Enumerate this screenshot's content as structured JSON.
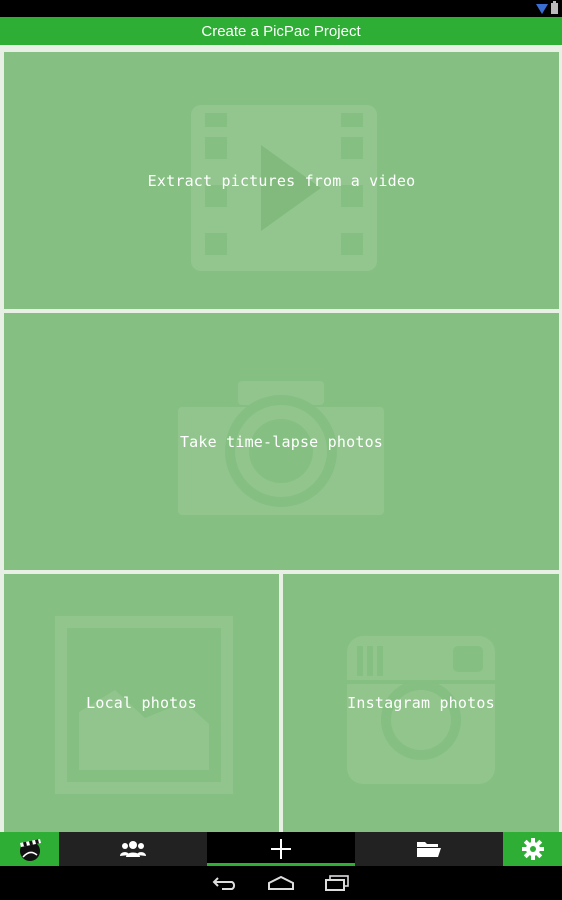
{
  "app": {
    "title": "Create a PicPac Project"
  },
  "status_bar": {
    "icons": [
      "signal-icon",
      "battery-icon"
    ]
  },
  "tiles": [
    {
      "label": "Extract pictures from a video",
      "icon": "film-play-icon"
    },
    {
      "label": "Take time-lapse photos",
      "icon": "camera-icon"
    },
    {
      "label": "Local photos",
      "icon": "image-icon"
    },
    {
      "label": "Instagram photos",
      "icon": "instagram-icon"
    }
  ],
  "bottom_nav": {
    "items": [
      {
        "icon": "clapperboard-icon",
        "selected": false
      },
      {
        "icon": "people-icon",
        "selected": false
      },
      {
        "icon": "plus-icon",
        "selected": true
      },
      {
        "icon": "folder-icon",
        "selected": false
      },
      {
        "icon": "gear-icon",
        "selected": false
      }
    ]
  },
  "system_nav": {
    "buttons": [
      "back-icon",
      "home-icon",
      "recent-apps-icon"
    ]
  },
  "colors": {
    "accent": "#2eae35",
    "tile": "#85bf82",
    "nav_bg": "#222222"
  }
}
